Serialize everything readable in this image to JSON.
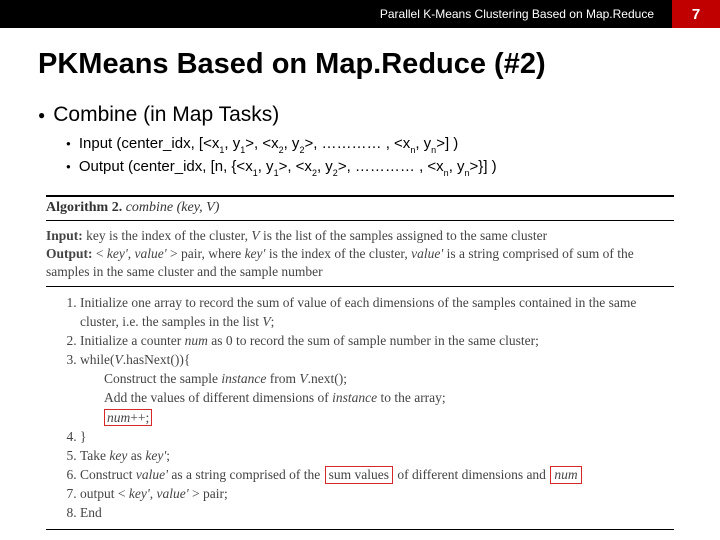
{
  "header": {
    "caption": "Parallel K-Means Clustering Based on Map.Reduce",
    "page": "7"
  },
  "title": "PKMeans Based on Map.Reduce (#2)",
  "bullets": {
    "combine": "Combine (in Map Tasks)",
    "input_pre": "Input (center_idx, [<x",
    "input_mid1": ", y",
    "input_mid2": ">, <x",
    "input_mid3": ", y",
    "input_mid4": ">, ………… , <x",
    "input_mid5": ", y",
    "input_end": ">] )",
    "output_pre": "Output (center_idx, [n, {<x",
    "output_mid1": ", y",
    "output_mid2": ">, <x",
    "output_mid3": ", y",
    "output_mid4": ">, ………… , <x",
    "output_mid5": ", y",
    "output_end": ">}] )"
  },
  "subs": {
    "s1": "1",
    "s2": "2",
    "sn": "n"
  },
  "algo": {
    "label": "Algorithm 2.",
    "name": "combine (key, V)",
    "input_lbl": "Input:",
    "input_txt_a": " key is the index of the cluster, ",
    "input_txt_b": " is the list of the samples assigned to the same cluster",
    "output_lbl": "Output:",
    "output_txt_a": " < ",
    "output_txt_b": " > pair, where ",
    "output_txt_c": " is the index of the cluster, ",
    "output_txt_d": " is a string comprised of sum of the samples in the same cluster and the sample number",
    "keyp": "key'",
    "valuep": "value'",
    "V": "V",
    "comma": ", ",
    "l1": "Initialize one array to record the sum of value of each dimensions of the samples contained in the same cluster, i.e. the samples in the list ",
    "l1b": ";",
    "l2a": "Initialize a counter ",
    "l2b": " as 0 to record the sum of sample number in the same cluster;",
    "l3a": "while(",
    "l3b": ".hasNext()){",
    "l3s1a": "Construct the sample ",
    "l3s1b": " from ",
    "l3s1c": ".next();",
    "l3s2a": "Add the values of different dimensions of ",
    "l3s2b": " to the array;",
    "l3s3": "++;",
    "l4": "}",
    "l5a": "Take ",
    "l5b": " as ",
    "l5c": ";",
    "l6a": "Construct ",
    "l6b": " as a string comprised of the ",
    "l6c": " of different dimensions and ",
    "l7a": "output < ",
    "l7b": " > pair;",
    "l8": "End",
    "num": "num",
    "instance": "instance",
    "key": "key",
    "sumvals": "sum values"
  }
}
